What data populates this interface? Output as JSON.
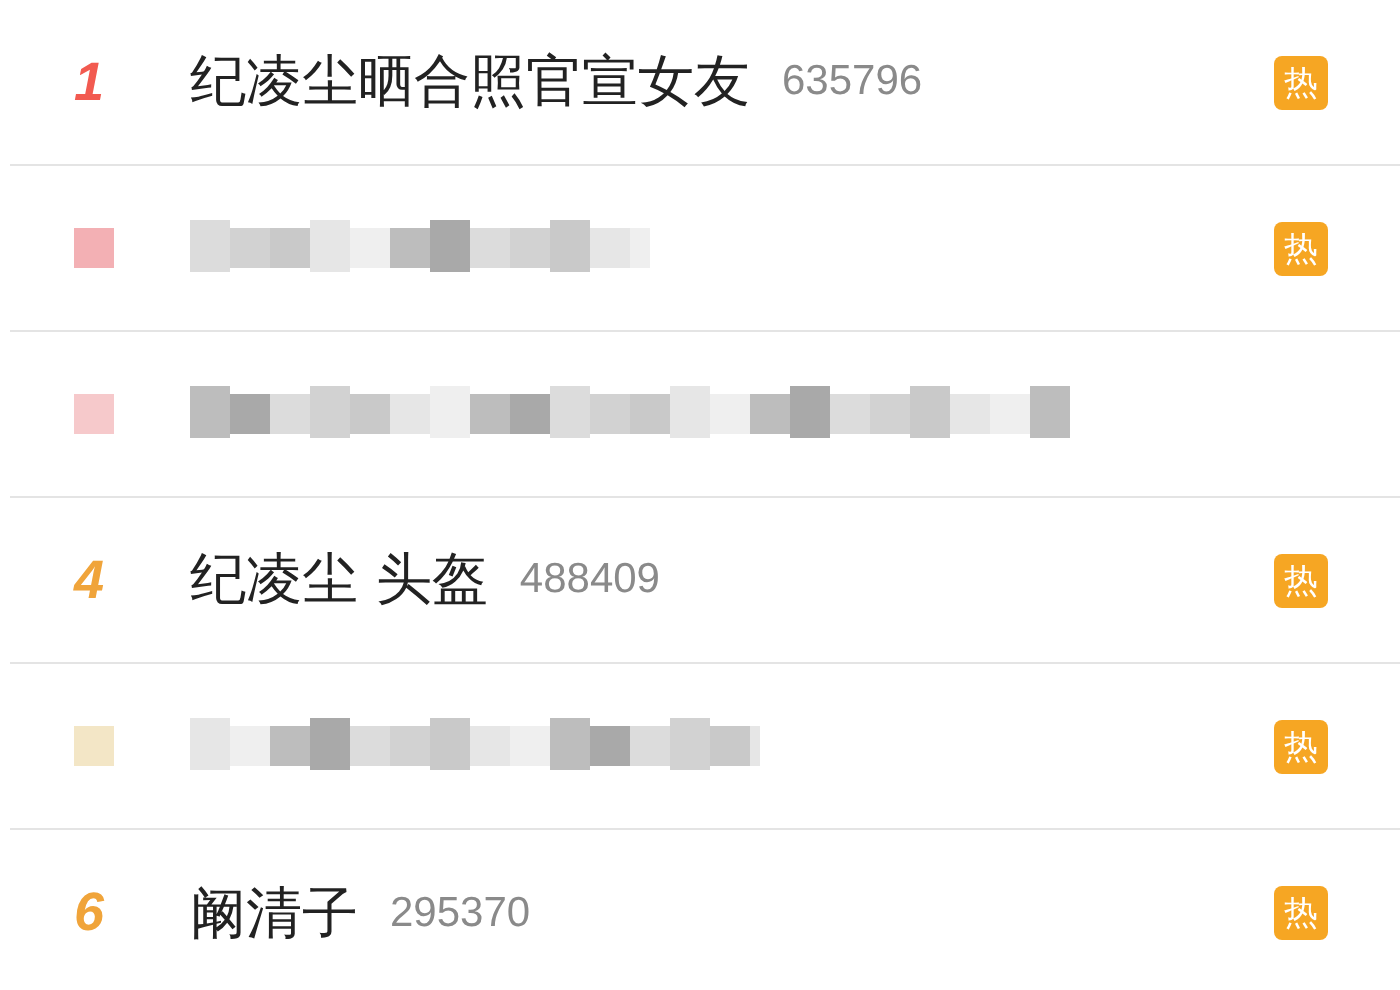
{
  "hot_list": [
    {
      "kind": "entry",
      "rank": "1",
      "title": "纪凌尘晒合照官宣女友",
      "count": "635796",
      "badge": "热",
      "color": "#f25a50"
    },
    {
      "kind": "blurred",
      "badge": "热",
      "color": "#f3b0b4"
    },
    {
      "kind": "blurred",
      "color": "#f6c9cb"
    },
    {
      "kind": "entry",
      "rank": "4",
      "title": "纪凌尘 头盔",
      "count": "488409",
      "badge": "热",
      "color": "#f0a43a"
    },
    {
      "kind": "blurred",
      "badge": "热",
      "color": "#f3e6c6"
    },
    {
      "kind": "entry",
      "rank": "6",
      "title": "阚清子",
      "count": "295370",
      "badge": "热",
      "color": "#f0a43a"
    }
  ]
}
